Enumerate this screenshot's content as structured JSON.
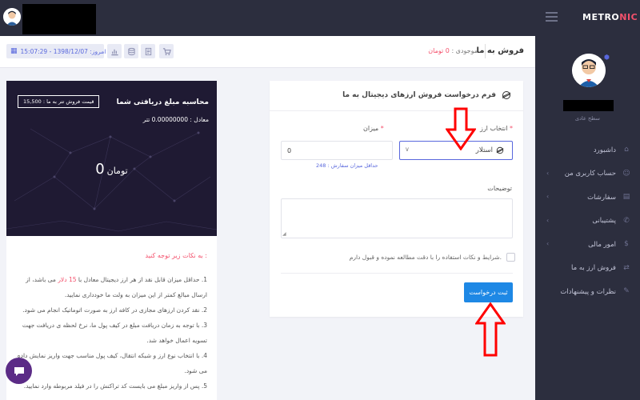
{
  "topbar": {
    "logo_main": "METRO",
    "logo_accent": "NIC"
  },
  "subheader": {
    "page_title": "فروش به ما",
    "balance_label": "موجودی :",
    "balance_value": "0 تومان",
    "date_text": "امروز: 1398/12/07 - 15:07:29",
    "tools": [
      "cart-icon",
      "docs-icon",
      "coins-icon",
      "chart-icon"
    ]
  },
  "sidebar": {
    "profile_level": "سطح عادی",
    "menu": [
      {
        "label": "داشبورد",
        "icon": "dashboard-icon",
        "chevron": false
      },
      {
        "label": "حساب کاربری من",
        "icon": "user-icon",
        "chevron": true
      },
      {
        "label": "سفارشات",
        "icon": "orders-icon",
        "chevron": true
      },
      {
        "label": "پشتیبانی",
        "icon": "support-icon",
        "chevron": true
      },
      {
        "label": "امور مالی",
        "icon": "finance-icon",
        "chevron": true
      },
      {
        "label": "فروش ارز به ما",
        "icon": "sell-icon",
        "chevron": false
      },
      {
        "label": "نظرات و پیشنهادات",
        "icon": "feedback-icon",
        "chevron": false
      }
    ]
  },
  "form": {
    "title": "فرم درخواست فروش ارزهای دیجیتال به ما",
    "currency_label": "انتخاب ارز",
    "currency_value": "استلار",
    "amount_label": "میزان",
    "amount_value": "0",
    "min_order": "حداقل میزان سفارش : 248",
    "notes_label": "توضیحات",
    "terms_label": "شرایط و نکات استفاده را با دقت مطالعه نموده و قبول دارم.",
    "submit_label": "ثبت درخواست",
    "required_mark": "*"
  },
  "calc": {
    "title": "محاسبه مبلغ دریافتی شما",
    "price_badge": "قیمت فروش تتر به ما : 15,500",
    "equal_text": "معادل : 0.00000000 تتر",
    "total_value": "0",
    "total_unit": "تومان"
  },
  "notes": {
    "title": "به نکات زیر توجه کنید :",
    "items": [
      {
        "pre": "1. حداقل میزان قابل نقد از هر ارز دیجیتال معادل با ",
        "hl": "15 دلار",
        "post": " می باشد، از ارسال مبالغ کمتر از این میزان به ولت ما خودداری نمایید."
      },
      {
        "pre": "2. نقد کردن ارزهای مجازی در کافه ارز به صورت اتوماتیک انجام می شود.",
        "hl": "",
        "post": ""
      },
      {
        "pre": "3. با توجه به زمان دریافت مبلغ در کیف پول ما، نرخ لحظه ی دریافت جهت تسویه اعمال خواهد شد.",
        "hl": "",
        "post": ""
      },
      {
        "pre": "4. با انتخاب نوع ارز و شبکه انتقال، کیف پول مناسب جهت واریز نمایش داده می شود.",
        "hl": "",
        "post": ""
      },
      {
        "pre": "5. پس از واریز مبلغ می بایست کد تراکنش را در فیلد مربوطه وارد نمایید.",
        "hl": "",
        "post": ""
      }
    ]
  },
  "colors": {
    "accent": "#f4516c",
    "primary": "#1e88e5",
    "sidebar_bg": "#2c2e3e",
    "calc_bg": "#1f1a33",
    "arrow": "#ff0000"
  }
}
